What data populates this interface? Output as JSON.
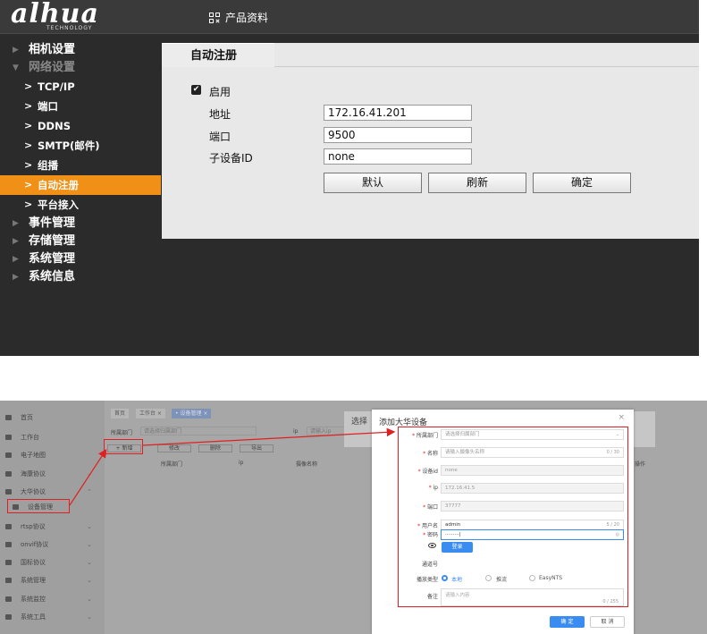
{
  "top": {
    "logo": "alhua",
    "logo_sub": "TECHNOLOGY",
    "product_link": "产品资料",
    "sidebar": {
      "camera": "相机设置",
      "network": "网络设置",
      "sub": [
        "TCP/IP",
        "端口",
        "DDNS",
        "SMTP(邮件)",
        "组播",
        "自动注册",
        "平台接入"
      ],
      "others": [
        "事件管理",
        "存储管理",
        "系统管理",
        "系统信息"
      ]
    },
    "tab_title": "自动注册",
    "enable_label": "启用",
    "fields": [
      {
        "label": "地址",
        "value": "172.16.41.201"
      },
      {
        "label": "端口",
        "value": "9500"
      },
      {
        "label": "子设备ID",
        "value": "none"
      }
    ],
    "buttons": [
      "默认",
      "刷新",
      "确定"
    ]
  },
  "bottom": {
    "sidebar": [
      {
        "label": "首页",
        "arrow": ""
      },
      {
        "label": "工作台",
        "arrow": ""
      },
      {
        "label": "电子地图",
        "arrow": ""
      },
      {
        "label": "海康协议",
        "arrow": "⌄"
      },
      {
        "label": "大华协议",
        "arrow": "⌃"
      },
      {
        "label": "设备管理",
        "arrow": ""
      },
      {
        "label": "rtsp协议",
        "arrow": "⌄"
      },
      {
        "label": "onvif协议",
        "arrow": "⌄"
      },
      {
        "label": "国标协议",
        "arrow": "⌄"
      },
      {
        "label": "系统管理",
        "arrow": "⌄"
      },
      {
        "label": "系统监控",
        "arrow": "⌄"
      },
      {
        "label": "系统工具",
        "arrow": "⌄"
      }
    ],
    "tabs": [
      "首页",
      "工作台 ×",
      "• 设备管理 ×"
    ],
    "filter": {
      "dept_label": "所属部门",
      "dept_placeholder": "请选择归属部门",
      "ip_label": "ip",
      "ip_placeholder": "请输入ip"
    },
    "toolbar": [
      "+ 新增",
      "修改",
      "删除",
      "导出"
    ],
    "table_headers": [
      "所属部门",
      "ip",
      "摄像名称"
    ],
    "table_extra": "操作",
    "behind_dialog_title": "选择",
    "dialog": {
      "title": "添加大华设备",
      "close": "×",
      "fields": [
        {
          "label": "所属部门",
          "required": true,
          "value": "请选择归属部门",
          "count": "⌄",
          "disabled": false,
          "filled": false
        },
        {
          "label": "名称",
          "required": true,
          "value": "请输入摄像头名称",
          "count": "0 / 30",
          "disabled": false,
          "filled": false
        },
        {
          "label": "设备id",
          "required": true,
          "value": "none",
          "count": "",
          "disabled": true,
          "filled": false
        },
        {
          "label": "ip",
          "required": true,
          "value": "172.16.41.5",
          "count": "",
          "disabled": true,
          "filled": false
        },
        {
          "label": "端口",
          "required": true,
          "value": "37777",
          "count": "",
          "disabled": true,
          "filled": false
        },
        {
          "label": "用户名",
          "required": true,
          "value": "admin",
          "count": "5 / 20",
          "disabled": false,
          "filled": true
        },
        {
          "label": "密码",
          "required": true,
          "value": "·········|",
          "count": "◎",
          "disabled": false,
          "filled": true
        }
      ],
      "login_button": "登录",
      "channel_label": "通道号",
      "play_type_label": "播放类型",
      "play_options": [
        "本地",
        "推流",
        "EasyNTS"
      ],
      "remark_label": "备注",
      "remark_placeholder": "请输入内容",
      "remark_count": "0 / 255",
      "ok": "确 定",
      "cancel": "取 消"
    }
  },
  "colors": {
    "accent_orange": "#f19016",
    "highlight_red": "#e02020",
    "primary_blue": "#3b8cf0"
  }
}
